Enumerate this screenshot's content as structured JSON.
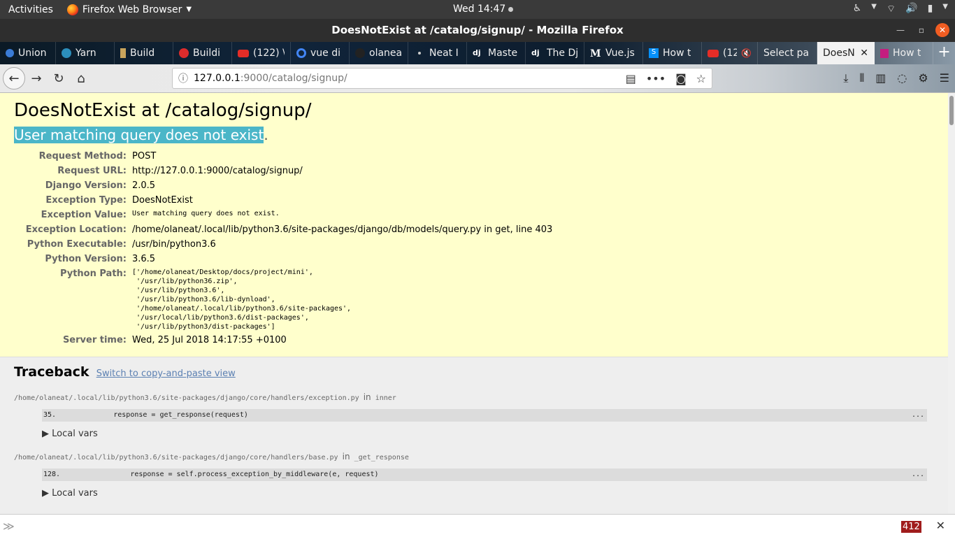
{
  "topbar": {
    "activities": "Activities",
    "app_menu": "Firefox Web Browser",
    "clock": "Wed 14:47"
  },
  "window": {
    "title": "DoesNotExist at /catalog/signup/ - Mozilla Firefox"
  },
  "tabs": [
    {
      "label": "Union",
      "favicon": "globe-icon"
    },
    {
      "label": "Yarn",
      "favicon": "yarn-icon"
    },
    {
      "label": "Build",
      "favicon": "build-icon"
    },
    {
      "label": "Buildi",
      "favicon": "angular-icon"
    },
    {
      "label": "(122) \\",
      "favicon": "youtube-icon"
    },
    {
      "label": "vue di",
      "favicon": "google-icon"
    },
    {
      "label": "olanea",
      "favicon": "github-icon"
    },
    {
      "label": "Neat I",
      "favicon": "dot-icon"
    },
    {
      "label": "Maste",
      "favicon": "django-icon"
    },
    {
      "label": "The Dj",
      "favicon": "django-icon"
    },
    {
      "label": "Vue.js",
      "favicon": "medium-icon"
    },
    {
      "label": "How t",
      "favicon": "stackshare-icon"
    },
    {
      "label": "(12",
      "favicon": "youtube-icon"
    },
    {
      "label": "Select pa",
      "favicon": "muted-icon"
    },
    {
      "label": "DoesN",
      "favicon": "none",
      "active": true
    },
    {
      "label": "How t",
      "favicon": "hexo-icon"
    }
  ],
  "urlbar": {
    "host": "127.0.0.1",
    "path": ":9000/catalog/signup/"
  },
  "page": {
    "title": "DoesNotExist at /catalog/signup/",
    "exception_value_highlighted": "User matching query does not exist",
    "exception_value_tail": ".",
    "meta": [
      {
        "label": "Request Method:",
        "value": "POST"
      },
      {
        "label": "Request URL:",
        "value": "http://127.0.0.1:9000/catalog/signup/"
      },
      {
        "label": "Django Version:",
        "value": "2.0.5"
      },
      {
        "label": "Exception Type:",
        "value": "DoesNotExist"
      },
      {
        "label": "Exception Value:",
        "value": "User matching query does not exist.",
        "mono": true
      },
      {
        "label": "Exception Location:",
        "value": "/home/olaneat/.local/lib/python3.6/site-packages/django/db/models/query.py in get, line 403"
      },
      {
        "label": "Python Executable:",
        "value": "/usr/bin/python3.6"
      },
      {
        "label": "Python Version:",
        "value": "3.6.5"
      },
      {
        "label": "Python Path:",
        "value": "['/home/olaneat/Desktop/docs/project/mini',\n '/usr/lib/python36.zip',\n '/usr/lib/python3.6',\n '/usr/lib/python3.6/lib-dynload',\n '/home/olaneat/.local/lib/python3.6/site-packages',\n '/usr/local/lib/python3.6/dist-packages',\n '/usr/lib/python3/dist-packages']",
        "mono": true
      },
      {
        "label": "Server time:",
        "value": "Wed, 25 Jul 2018 14:17:55 +0100"
      }
    ],
    "traceback": {
      "heading": "Traceback",
      "switch_link": "Switch to copy-and-paste view",
      "frames": [
        {
          "file": "/home/olaneat/.local/lib/python3.6/site-packages/django/core/handlers/exception.py",
          "in_word": "in",
          "function": "inner",
          "line_no": "35.",
          "code": "            response = get_response(request)",
          "more": "...",
          "local_vars": "▶ Local vars"
        },
        {
          "file": "/home/olaneat/.local/lib/python3.6/site-packages/django/core/handlers/base.py",
          "in_word": "in",
          "function": "_get_response",
          "line_no": "128.",
          "code": "                response = self.process_exception_by_middleware(e, request)",
          "more": "...",
          "local_vars": "▶ Local vars"
        }
      ]
    }
  },
  "bottombar": {
    "count": "412"
  },
  "colors": {
    "summary_bg": "#ffffcc",
    "highlight": "#4bb6c8",
    "traceback_bg": "#eeeeee",
    "count_badge": "#a01c1c"
  }
}
